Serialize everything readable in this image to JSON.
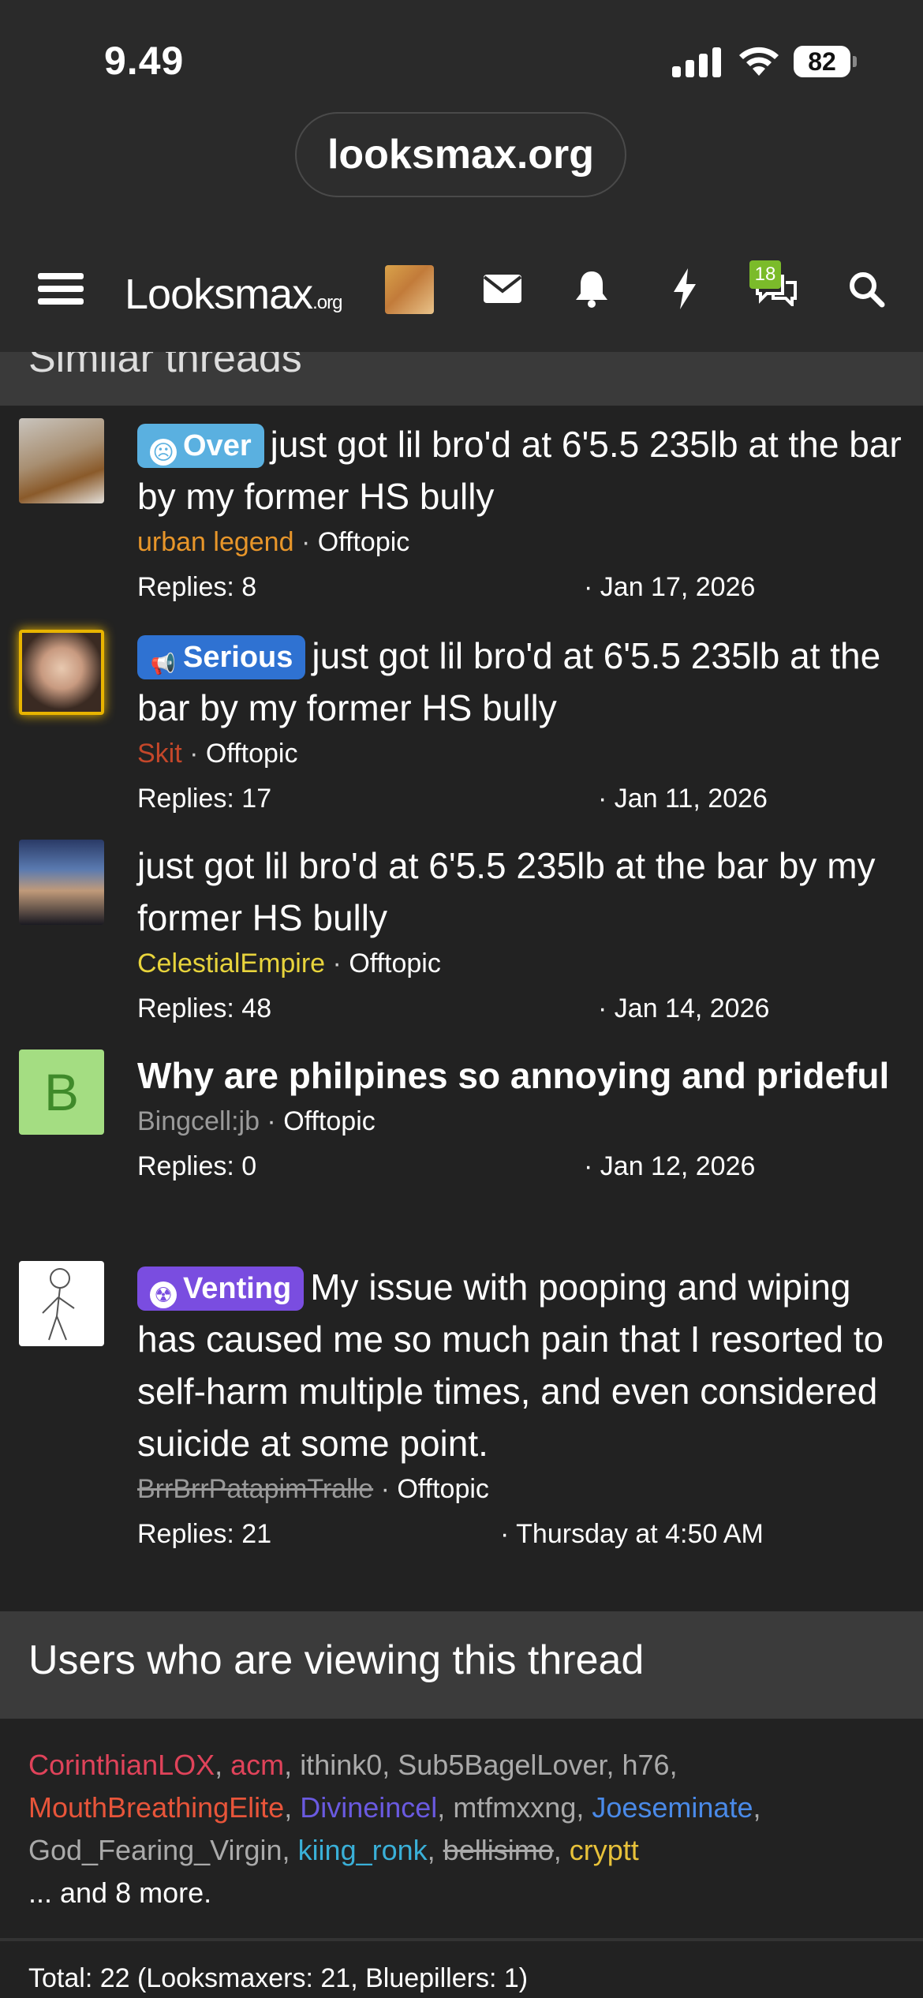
{
  "status": {
    "time": "9.49",
    "battery": "82"
  },
  "browser": {
    "url": "looksmax.org"
  },
  "nav": {
    "logo_main": "Looksmax",
    "logo_suffix": ".org",
    "conversations_badge": "18"
  },
  "similar": {
    "header": "Similar threads",
    "threads": [
      {
        "label": "Over",
        "label_color": "#5ab0e0",
        "title": "just got lil bro'd at 6'5.5 235lb at the bar by my former HS bully",
        "author": "urban legend",
        "author_color": "#e8962a",
        "forum": "Offtopic",
        "replies": "Replies: 8",
        "date": "Jan 17, 2026"
      },
      {
        "label": "Serious",
        "label_color": "#2f72d2",
        "title": "just got lil bro'd at 6'5.5 235lb at the bar by my former HS bully",
        "author": "Skit",
        "author_color": "#c4472a",
        "forum": "Offtopic",
        "replies": "Replies: 17",
        "date": "Jan 11, 2026"
      },
      {
        "label": "",
        "title": "just got lil bro'd at 6'5.5 235lb at the bar by my former HS bully",
        "author": "CelestialEmpire",
        "author_color": "#e8d43c",
        "forum": "Offtopic",
        "replies": "Replies: 48",
        "date": "Jan 14, 2026"
      },
      {
        "label": "",
        "avatar_letter": "B",
        "title": "Why are philpines so annoying and prideful",
        "author": "Bingcell:jb",
        "author_color": "#9a9a9a",
        "forum": "Offtopic",
        "replies": "Replies: 0",
        "date": "Jan 12, 2026"
      },
      {
        "label": "Venting",
        "label_color": "#7a4de0",
        "title": "My issue with pooping and wiping has caused me so much pain that I resorted to self-harm multiple times, and even considered suicide at some point.",
        "author": "BrrBrrPatapimTralle",
        "author_color": "#9a9a9a",
        "forum": "Offtopic",
        "replies": "Replies: 21",
        "date": "Thursday at 4:50 AM"
      }
    ]
  },
  "viewing": {
    "header": "Users who are viewing this thread",
    "users": [
      {
        "name": "CorinthianLOX",
        "color": "#e0435a"
      },
      {
        "name": "acm",
        "color": "#e0435a"
      },
      {
        "name": "ithink0",
        "color": "#9a9a9a"
      },
      {
        "name": "Sub5BagelLover",
        "color": "#9a9a9a"
      },
      {
        "name": "h76",
        "color": "#9a9a9a"
      },
      {
        "name": "MouthBreathingElite",
        "color": "#e8553a"
      },
      {
        "name": "Divineincel",
        "color": "#6a5ae0"
      },
      {
        "name": "mtfmxxng",
        "color": "#9a9a9a"
      },
      {
        "name": "Joeseminate",
        "color": "#4a8ae8"
      },
      {
        "name": "God_Fearing_Virgin",
        "color": "#9a9a9a"
      },
      {
        "name": "kiing_ronk",
        "color": "#3ab0d8"
      },
      {
        "name": "bellisimo",
        "color": "#9a9a9a"
      },
      {
        "name": "cryptt",
        "color": "#e8c23a"
      }
    ],
    "more": "... and 8 more.",
    "total": "Total: 22 (Looksmaxers: 21, Bluepillers: 1)"
  }
}
